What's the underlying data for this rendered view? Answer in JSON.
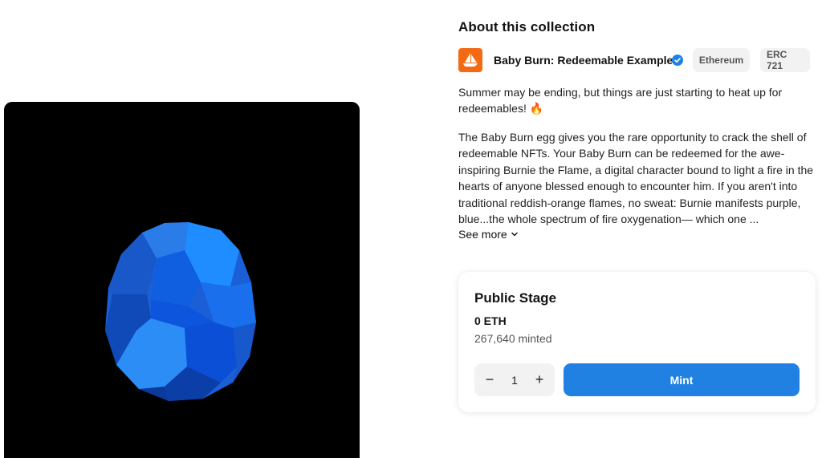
{
  "media": {
    "alt": "Baby Burn blue egg"
  },
  "about": {
    "title": "About this collection"
  },
  "collection": {
    "name": "Baby Burn: Redeemable Example",
    "chain": "Ethereum",
    "standard": "ERC 721",
    "logo_icon": "opensea-ship-icon",
    "verified_icon": "verified-check-icon",
    "brand_color": "#f46a14"
  },
  "description": {
    "paragraph1": "Summer may be ending, but things are just starting to heat up for redeemables! 🔥",
    "paragraph2": "The Baby Burn egg gives you the rare opportunity to crack the shell of redeemable NFTs. Your Baby Burn can be redeemed for the awe-inspiring Burnie the Flame, a digital character bound to light a fire in the hearts of anyone blessed enough to encounter him. If you aren't into traditional reddish-orange flames, no sweat: Burnie manifests purple, blue...the whole spectrum of fire oxygenation— which one ...",
    "see_more": "See more"
  },
  "stage": {
    "title": "Public Stage",
    "price": "0 ETH",
    "minted": "267,640 minted",
    "quantity": "1",
    "minus": "−",
    "plus": "+",
    "mint_label": "Mint",
    "accent": "#2081e2"
  }
}
